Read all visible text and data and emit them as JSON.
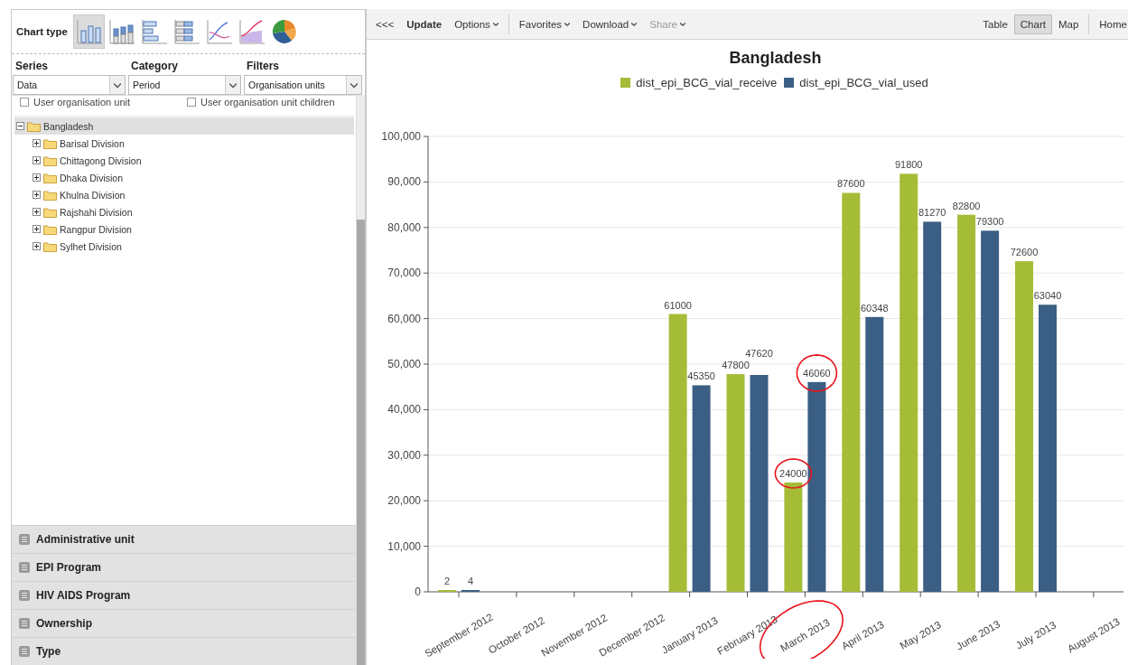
{
  "sidebar": {
    "chart_type": {
      "label": "Chart type",
      "types": [
        {
          "kind": "column",
          "selected": true
        },
        {
          "kind": "stacked_column",
          "selected": false
        },
        {
          "kind": "bar",
          "selected": false
        },
        {
          "kind": "stacked_bar",
          "selected": false
        },
        {
          "kind": "line",
          "selected": false
        },
        {
          "kind": "area",
          "selected": false
        },
        {
          "kind": "pie",
          "selected": false
        }
      ]
    },
    "layout": [
      {
        "label": "Series",
        "value": "Data"
      },
      {
        "label": "Category",
        "value": "Period"
      },
      {
        "label": "Filters",
        "value": "Organisation units"
      }
    ],
    "org_options": [
      {
        "label": "User organisation unit",
        "checked": false
      },
      {
        "label": "User organisation unit children",
        "checked": false
      }
    ],
    "org_tree": [
      {
        "label": "Bangladesh",
        "expanded": true,
        "selected": true,
        "children": [
          {
            "label": "Barisal Division",
            "expanded": false,
            "selected": false
          },
          {
            "label": "Chittagong Division",
            "expanded": false,
            "selected": false
          },
          {
            "label": "Dhaka Division",
            "expanded": false,
            "selected": false
          },
          {
            "label": "Khulna Division",
            "expanded": false,
            "selected": false
          },
          {
            "label": "Rajshahi Division",
            "expanded": false,
            "selected": false
          },
          {
            "label": "Rangpur Division",
            "expanded": false,
            "selected": false
          },
          {
            "label": "Sylhet Division",
            "expanded": false,
            "selected": false
          }
        ]
      }
    ],
    "panels": [
      {
        "label": "Administrative unit"
      },
      {
        "label": "EPI Program"
      },
      {
        "label": "HIV AIDS Program"
      },
      {
        "label": "Ownership"
      },
      {
        "label": "Type"
      }
    ]
  },
  "toolbar": {
    "items": [
      {
        "kind": "plain",
        "label": "<<<"
      },
      {
        "kind": "bold",
        "label": "Update"
      },
      {
        "kind": "menu",
        "label": "Options",
        "disabled": false
      },
      {
        "kind": "separator"
      },
      {
        "kind": "menu",
        "label": "Favorites",
        "disabled": false
      },
      {
        "kind": "menu",
        "label": "Download",
        "disabled": false
      },
      {
        "kind": "menu",
        "label": "Share",
        "disabled": true
      }
    ],
    "views": [
      {
        "label": "Table",
        "selected": false
      },
      {
        "label": "Chart",
        "selected": true
      },
      {
        "label": "Map",
        "selected": false
      }
    ],
    "home": "Home"
  },
  "chart": {
    "chart_data": {
      "type": "bar",
      "title": "Bangladesh",
      "categories": [
        "September 2012",
        "October 2012",
        "November 2012",
        "December 2012",
        "January 2013",
        "February 2013",
        "March 2013",
        "April 2013",
        "May 2013",
        "June 2013",
        "July 2013",
        "August 2013"
      ],
      "series": [
        {
          "name": "dist_epi_BCG_vial_receive",
          "color": "#a5bc37",
          "values": [
            2,
            null,
            null,
            null,
            61000,
            47800,
            24000,
            87600,
            91800,
            82800,
            72600,
            null
          ]
        },
        {
          "name": "dist_epi_BCG_vial_used",
          "color": "#3b5f84",
          "values": [
            4,
            null,
            null,
            null,
            45350,
            47620,
            46060,
            60348,
            81270,
            79300,
            63040,
            null
          ]
        }
      ],
      "ylim": [
        0,
        100000
      ],
      "yticks": [
        {
          "value": 0,
          "label": "0"
        },
        {
          "value": 10000,
          "label": "10,000"
        },
        {
          "value": 20000,
          "label": "20,000"
        },
        {
          "value": 30000,
          "label": "30,000"
        },
        {
          "value": 40000,
          "label": "40,000"
        },
        {
          "value": 50000,
          "label": "50,000"
        },
        {
          "value": 60000,
          "label": "60,000"
        },
        {
          "value": 70000,
          "label": "70,000"
        },
        {
          "value": 80000,
          "label": "80,000"
        },
        {
          "value": 90000,
          "label": "90,000"
        },
        {
          "value": 100000,
          "label": "100,000"
        }
      ],
      "data_labels": true,
      "grid": true,
      "legend": "top"
    }
  }
}
